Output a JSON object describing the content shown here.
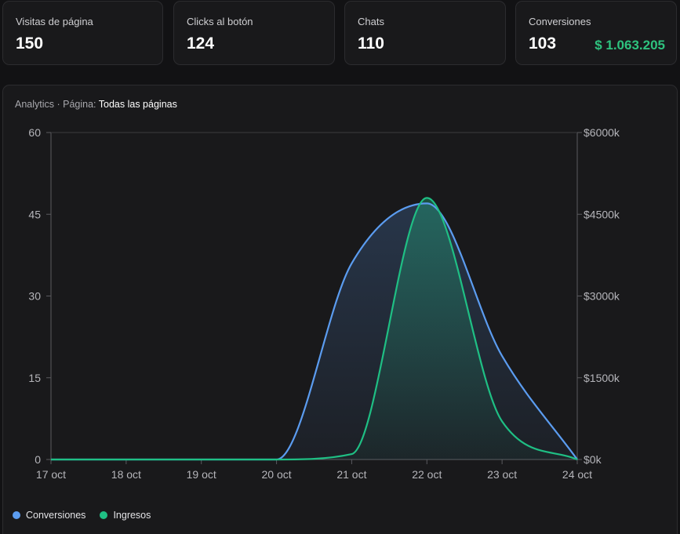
{
  "cards": [
    {
      "label": "Visitas de página",
      "value": "150"
    },
    {
      "label": "Clicks al botón",
      "value": "124"
    },
    {
      "label": "Chats",
      "value": "110"
    },
    {
      "label": "Conversiones",
      "value": "103",
      "extra": "$ 1.063.205"
    }
  ],
  "panel": {
    "prefix": "Analytics · Página: ",
    "filter": "Todas las páginas"
  },
  "colors": {
    "conversiones": "#5b9cf0",
    "ingresos": "#1fbf84"
  },
  "chart_data": {
    "type": "area",
    "categories": [
      "17 oct",
      "18 oct",
      "19 oct",
      "20 oct",
      "21 oct",
      "22 oct",
      "23 oct",
      "24 oct"
    ],
    "series": [
      {
        "name": "Conversiones",
        "axis": "left",
        "values": [
          0,
          0,
          0,
          0,
          36,
          47,
          19,
          0
        ]
      },
      {
        "name": "Ingresos",
        "axis": "right",
        "values": [
          0,
          0,
          0,
          0,
          100,
          4800,
          700,
          0
        ]
      }
    ],
    "y_left": {
      "ticks": [
        "0",
        "15",
        "30",
        "45",
        "60"
      ],
      "range": [
        0,
        60
      ]
    },
    "y_right": {
      "ticks": [
        "$0k",
        "$1500k",
        "$3000k",
        "$4500k",
        "$6000k"
      ],
      "range": [
        0,
        6000
      ]
    },
    "legend": [
      "Conversiones",
      "Ingresos"
    ],
    "legend_position": "bottom-left",
    "grid": false
  }
}
